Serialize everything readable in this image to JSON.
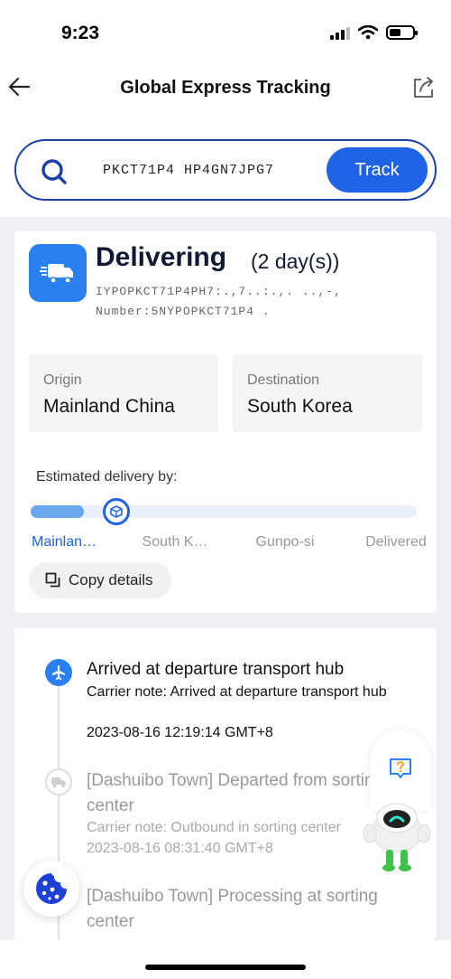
{
  "status_bar": {
    "time": "9:23"
  },
  "nav": {
    "title": "Global Express Tracking"
  },
  "search": {
    "value": "PKCT71P4 HP4GN7JPG7",
    "track_label": "Track"
  },
  "shipment": {
    "status": "Delivering",
    "duration": "(2 day(s))",
    "carrier_line_1": "IYPOPKCT71P4PH7:.,7..:.,. ..,-,",
    "carrier_line_2": "Number:5NYPOPKCT71P4 ."
  },
  "origin": {
    "label": "Origin",
    "value": "Mainland China"
  },
  "destination": {
    "label": "Destination",
    "value": "South Korea"
  },
  "eta": {
    "label": "Estimated delivery by:"
  },
  "progress": {
    "fraction": 0.11,
    "steps": [
      "Mainlan…",
      "South K…",
      "Gunpo-si",
      "Delivered"
    ]
  },
  "copy": {
    "label": "Copy details"
  },
  "timeline": [
    {
      "title": "Arrived at departure transport hub",
      "note": "Carrier note: Arrived at departure transport hub",
      "time": "2023-08-16 12:19:14 GMT+8",
      "icon": "airplane-icon"
    },
    {
      "title": "[Dashuibo Town] Departed from sorting center",
      "note": "Carrier note: Outbound in sorting center",
      "time": "2023-08-16 08:31:40 GMT+8",
      "icon": "truck-icon"
    },
    {
      "title": "[Dashuibo Town] Processing at sorting center"
    }
  ],
  "colors": {
    "accent": "#1e62e6",
    "brand_blue": "#2b80f0",
    "border_navy": "#1b3fa3"
  }
}
